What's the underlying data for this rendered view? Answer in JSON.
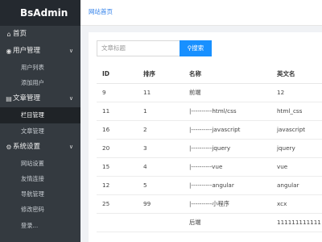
{
  "app": {
    "title": "BsAdmin"
  },
  "topbar": {
    "breadcrumb": "网站首页"
  },
  "sidebar": {
    "home": {
      "label": "首页",
      "icon": "home-icon"
    },
    "groups": [
      {
        "label": "用户管理",
        "icon": "user-circle-icon",
        "items": [
          "用户列表",
          "添加用户"
        ]
      },
      {
        "label": "文章管理",
        "icon": "document-icon",
        "items": [
          "栏目管理",
          "文章管理"
        ],
        "active_item": "栏目管理"
      },
      {
        "label": "系统设置",
        "icon": "gear-icon",
        "items": [
          "网站设置",
          "友情连接",
          "导航管理",
          "修改密码",
          "登录..."
        ]
      }
    ]
  },
  "search": {
    "placeholder": "文章标题",
    "button_label": "搜索",
    "button_icon": "search-icon"
  },
  "table": {
    "headers": [
      "ID",
      "排序",
      "名称",
      "英文名"
    ],
    "rows": [
      [
        "9",
        "11",
        "前端",
        "12"
      ],
      [
        "11",
        "1",
        "|----------html/css",
        "html_css"
      ],
      [
        "16",
        "2",
        "|----------javascript",
        "javascript"
      ],
      [
        "20",
        "3",
        "|----------jquery",
        "jquery"
      ],
      [
        "15",
        "4",
        "|----------vue",
        "vue"
      ],
      [
        "12",
        "5",
        "|----------angular",
        "angular"
      ],
      [
        "25",
        "99",
        "|----------小程序",
        "xcx"
      ],
      [
        "",
        "",
        "后端",
        "111111111111"
      ]
    ]
  },
  "colors": {
    "sidebar_bg": "#343a40",
    "logo_bg": "#24292f",
    "active_bg": "#1f2327",
    "primary": "#1890ff",
    "link": "#2b7de9"
  }
}
